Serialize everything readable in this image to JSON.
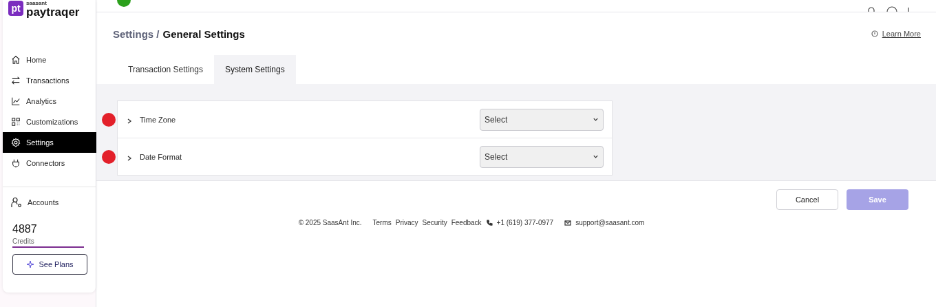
{
  "brand": {
    "badge": "pt",
    "maker": "saasant",
    "name": "paytraqer"
  },
  "sidebar": {
    "items": [
      {
        "label": "Home",
        "selected": false
      },
      {
        "label": "Transactions",
        "selected": false
      },
      {
        "label": "Analytics",
        "selected": false
      },
      {
        "label": "Customizations",
        "selected": false
      },
      {
        "label": "Settings",
        "selected": true
      },
      {
        "label": "Connectors",
        "selected": false
      }
    ],
    "accounts": "Accounts",
    "credits": {
      "value": "4887",
      "label": "Credits"
    },
    "see_plans": "See Plans"
  },
  "breadcrumb": {
    "parent": "Settings /",
    "current": "General Settings"
  },
  "learn_more": "Learn More",
  "tabs": [
    {
      "label": "Transaction Settings",
      "selected": false
    },
    {
      "label": "System Settings",
      "selected": true
    }
  ],
  "settings": [
    {
      "label": "Time Zone",
      "value": "Select",
      "expanded": false,
      "marked": true
    },
    {
      "label": "Date Format",
      "value": "Select",
      "expanded": false,
      "marked": true
    }
  ],
  "buttons": {
    "cancel": "Cancel",
    "save": "Save",
    "save_disabled": true
  },
  "footer": {
    "copyright": "© 2025 SaasAnt Inc.",
    "links": [
      "Terms",
      "Privacy",
      "Security",
      "Feedback"
    ],
    "phone": "+1 (619) 377-0977",
    "email": "support@saasant.com"
  }
}
